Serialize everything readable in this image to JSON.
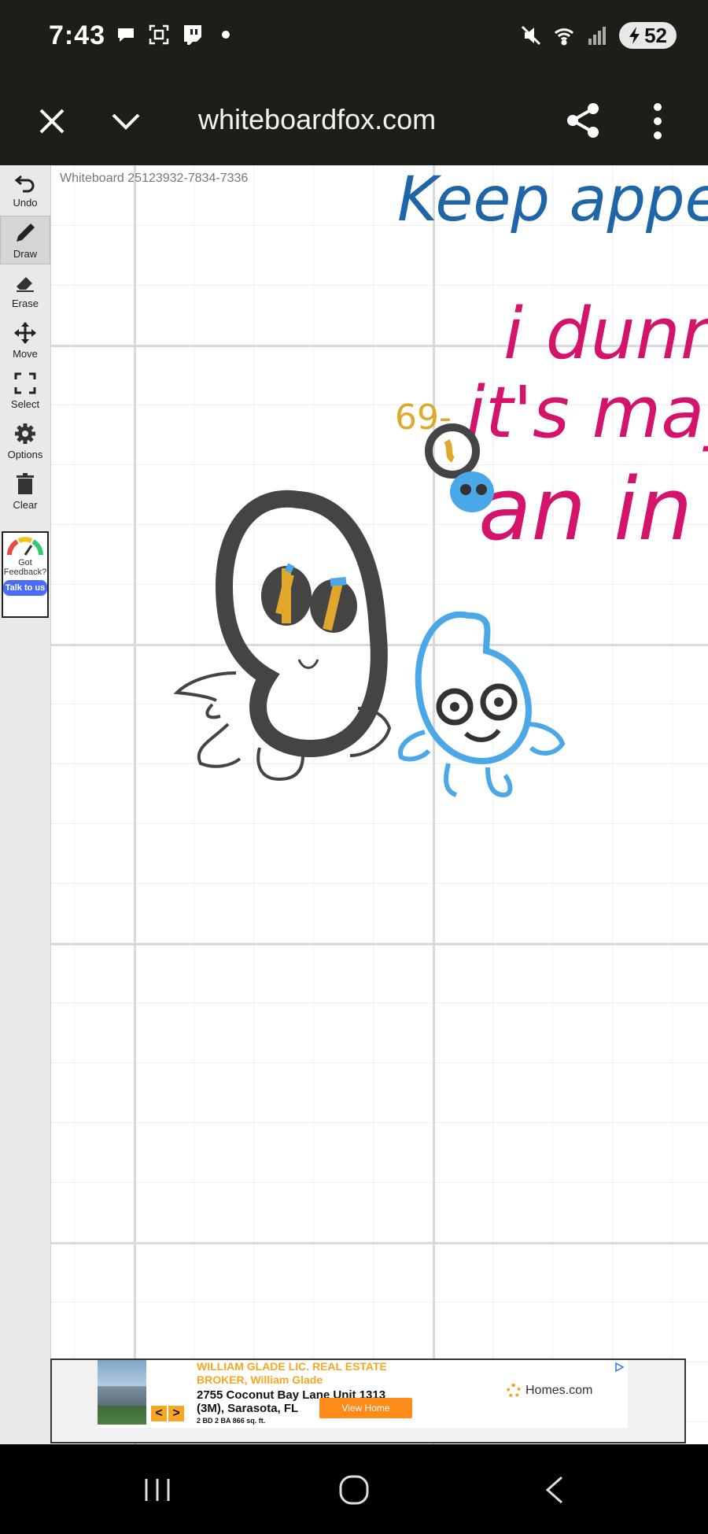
{
  "status_bar": {
    "time": "7:43",
    "battery": "52",
    "icons_left": [
      "chat-bubble-icon",
      "screenshot-icon",
      "twitch-icon",
      "dot-icon"
    ],
    "icons_right": [
      "mute-icon",
      "wifi-icon",
      "signal-icon",
      "battery-icon"
    ]
  },
  "browser": {
    "url": "whiteboardfox.com",
    "actions": [
      "close-icon",
      "chevron-down-icon",
      "share-icon",
      "more-icon"
    ]
  },
  "board": {
    "label": "Whiteboard 25123932-7834-7336",
    "handwriting": {
      "line1": "Keep appe",
      "line2": "i dunn",
      "line3": "it's may",
      "line4": "an in",
      "small": "69-"
    },
    "colors": {
      "blue_ink": "#1f66a8",
      "pink_ink": "#d4136b",
      "dark_ink": "#444444",
      "light_blue": "#4aa8e8",
      "yellow": "#e0a82a"
    }
  },
  "toolbar": {
    "undo": "Undo",
    "draw": "Draw",
    "erase": "Erase",
    "move": "Move",
    "select": "Select",
    "options": "Options",
    "clear": "Clear"
  },
  "feedback": {
    "text": "Got Feedback?",
    "button": "Talk to us"
  },
  "ad": {
    "headline": "WILLIAM GLADE LIC. REAL ESTATE BROKER, William Glade",
    "address": "2755 Coconut Bay Lane Unit 1313 (3M), Sarasota, FL",
    "details": "2 BD 2 BA 866 sq. ft.",
    "cta": "View Home",
    "brand": "Homes.com",
    "prev": "<",
    "next": ">"
  },
  "nav": {
    "buttons": [
      "recent-apps-icon",
      "home-icon",
      "back-icon"
    ]
  }
}
